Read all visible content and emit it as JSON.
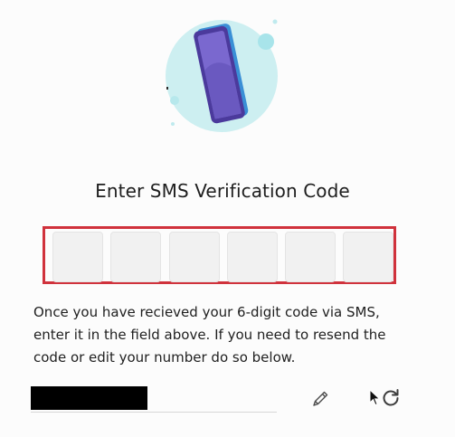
{
  "title": "Enter SMS Verification Code",
  "code_digits": [
    "",
    "",
    "",
    "",
    "",
    ""
  ],
  "instructions": "Once you have recieved your 6-digit code via SMS, enter it in the field above. If you need to resend the code or edit your number do so below.",
  "phone_number": "",
  "icons": {
    "illustration": "phone-illustration",
    "edit": "pencil-icon",
    "resend": "refresh-icon",
    "cursor": "mouse-cursor-icon"
  },
  "colors": {
    "highlight_border": "#d0323c",
    "circle": "#cdeff1",
    "phone_body": "#6e5fc4",
    "phone_edge": "#3f8fd8"
  }
}
